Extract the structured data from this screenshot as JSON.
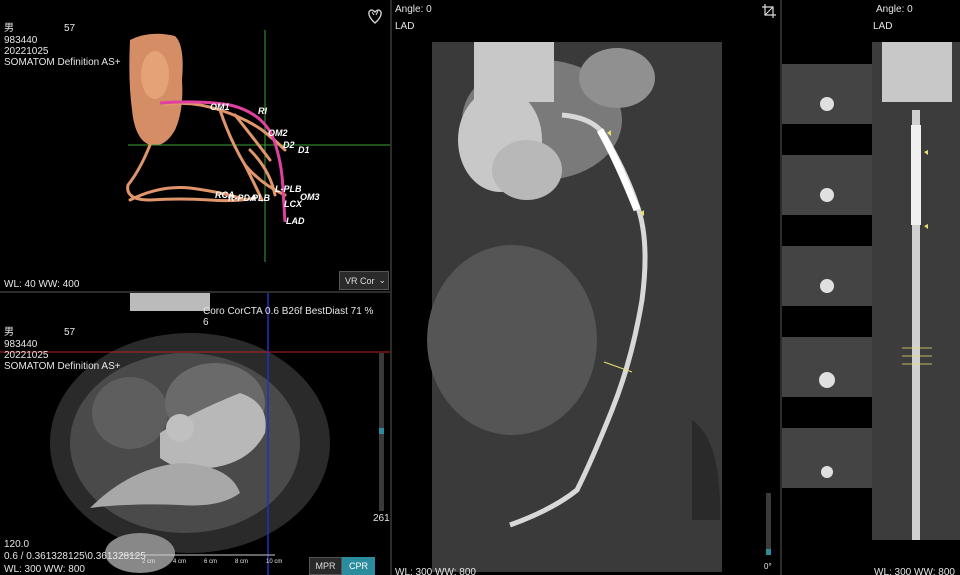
{
  "vr_panel": {
    "patient_sex": "男",
    "patient_age": "57",
    "patient_id": "983440",
    "study_date": "20221025",
    "scanner": "SOMATOM Definition AS+",
    "wl_ww": "WL: 40 WW: 400",
    "mode_dropdown": "VR Cor",
    "vessel_labels": {
      "om1": "OM1",
      "ri": "RI",
      "om2": "OM2",
      "d2": "D2",
      "d1": "D1",
      "rca": "RCA",
      "pda": "R-PDA",
      "plb_r": "PLB",
      "plb_l": "L-PLB",
      "om3": "OM3",
      "lcx": "LCX",
      "lad": "LAD"
    }
  },
  "axial_panel": {
    "patient_sex": "男",
    "patient_age": "57",
    "patient_id": "983440",
    "study_date": "20221025",
    "scanner": "SOMATOM Definition AS+",
    "protocol_line1": "Coro  CorCTA  0.6  B26f  BestDiast 71 %",
    "protocol_line2": "6",
    "slice_value": "120.0",
    "pixel_spacing": "0.6 / 0.361328125\\0.361328125",
    "wl_ww": "WL: 300 WW: 800",
    "slider_value": "261",
    "scale_marks": [
      "2 cm",
      "4 cm",
      "6 cm",
      "8 cm",
      "10 cm"
    ],
    "mpr_button": "MPR",
    "cpr_button": "CPR"
  },
  "cpr_panel": {
    "angle": "Angle: 0",
    "vessel": "LAD",
    "wl_ww": "WL: 300 WW: 800",
    "slider_value": "0°"
  },
  "straight_panel": {
    "angle": "Angle: 0",
    "vessel": "LAD",
    "wl_ww": "WL: 300 WW: 800"
  },
  "colors": {
    "vessel_tree": "#e0956b",
    "lad_highlight": "#e040a0",
    "crosshair_green": "#3ca03c",
    "crosshair_red": "#c02020",
    "crosshair_blue": "#2030c0",
    "marker_yellow": "#e8e070",
    "active_button": "#2a8c9c"
  }
}
